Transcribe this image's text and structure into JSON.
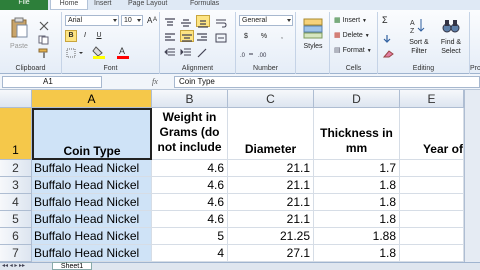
{
  "tabs": [
    "File",
    "Home",
    "Insert",
    "Page Layout",
    "Formulas"
  ],
  "ribbon": {
    "clipboard": {
      "label": "Clipboard",
      "paste": "Paste"
    },
    "font": {
      "label": "Font",
      "name": "Arial",
      "size": "10",
      "bold": "B",
      "italic": "I",
      "underline": "U",
      "grow": "A",
      "shrink": "A",
      "fill_color": "#ffff00",
      "font_color": "#ff0000"
    },
    "alignment": {
      "label": "Alignment"
    },
    "number": {
      "label": "Number",
      "format": "General",
      "currency": "$",
      "percent": "%",
      "comma": ","
    },
    "styles": {
      "label": "Styles"
    },
    "cells": {
      "label": "Cells",
      "insert": "Insert",
      "delete": "Delete",
      "format": "Format"
    },
    "editing": {
      "label": "Editing",
      "sum": "Σ",
      "sort": "Sort &",
      "sort2": "Filter",
      "find": "Find &",
      "find2": "Select"
    },
    "pro": {
      "label": "Pro"
    }
  },
  "formula_bar": {
    "name_box": "A1",
    "fx": "fx",
    "formula": "Coin Type"
  },
  "columns": [
    "A",
    "B",
    "C",
    "D",
    "E"
  ],
  "rows": [
    "1",
    "2",
    "3",
    "4",
    "5",
    "6",
    "7"
  ],
  "header_row": {
    "A": "Coin Type",
    "B1": "Weight in",
    "B2": "Grams (do",
    "B3": "not include",
    "C": "Diameter",
    "D1": "Thickness in",
    "D2": "mm",
    "E": "Year of"
  },
  "data": [
    {
      "a": "Buffalo Head Nickel",
      "b": "4.6",
      "c": "21.1",
      "d": "1.7"
    },
    {
      "a": "Buffalo Head Nickel",
      "b": "4.6",
      "c": "21.1",
      "d": "1.8"
    },
    {
      "a": "Buffalo Head Nickel",
      "b": "4.6",
      "c": "21.1",
      "d": "1.8"
    },
    {
      "a": "Buffalo Head Nickel",
      "b": "4.6",
      "c": "21.1",
      "d": "1.8"
    },
    {
      "a": "Buffalo Head Nickel",
      "b": "5",
      "c": "21.25",
      "d": "1.88"
    },
    {
      "a": "Buffalo Head Nickel",
      "b": "4",
      "c": "27.1",
      "d": "1.8"
    }
  ],
  "sheet_tab": "Sheet1"
}
